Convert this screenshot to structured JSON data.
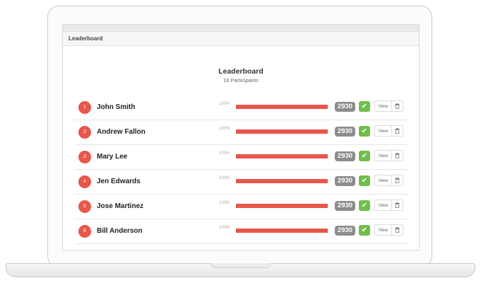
{
  "panel": {
    "header": "Leaderboard"
  },
  "leaderboard": {
    "title": "Leaderboard",
    "subtitle": "16 Participants",
    "rows": [
      {
        "rank": "1",
        "name": "John Smith",
        "percent_label": "100%",
        "progress": 1.0,
        "score": "2930",
        "action_label": "View"
      },
      {
        "rank": "2",
        "name": "Andrew Fallon",
        "percent_label": "100%",
        "progress": 1.0,
        "score": "2930",
        "action_label": "View"
      },
      {
        "rank": "3",
        "name": "Mary Lee",
        "percent_label": "100%",
        "progress": 1.0,
        "score": "2930",
        "action_label": "View"
      },
      {
        "rank": "4",
        "name": "Jen Edwards",
        "percent_label": "100%",
        "progress": 1.0,
        "score": "2930",
        "action_label": "View"
      },
      {
        "rank": "5",
        "name": "Jose Martinez",
        "percent_label": "100%",
        "progress": 1.0,
        "score": "2930",
        "action_label": "View"
      },
      {
        "rank": "6",
        "name": "Bill Anderson",
        "percent_label": "100%",
        "progress": 1.0,
        "score": "2930",
        "action_label": "View"
      }
    ]
  },
  "icons": {
    "verified": "check-icon",
    "delete": "trash-icon"
  },
  "colors": {
    "accent": "#e8574a",
    "score_badge": "#8c8c8c",
    "verified": "#6fbf4a"
  }
}
